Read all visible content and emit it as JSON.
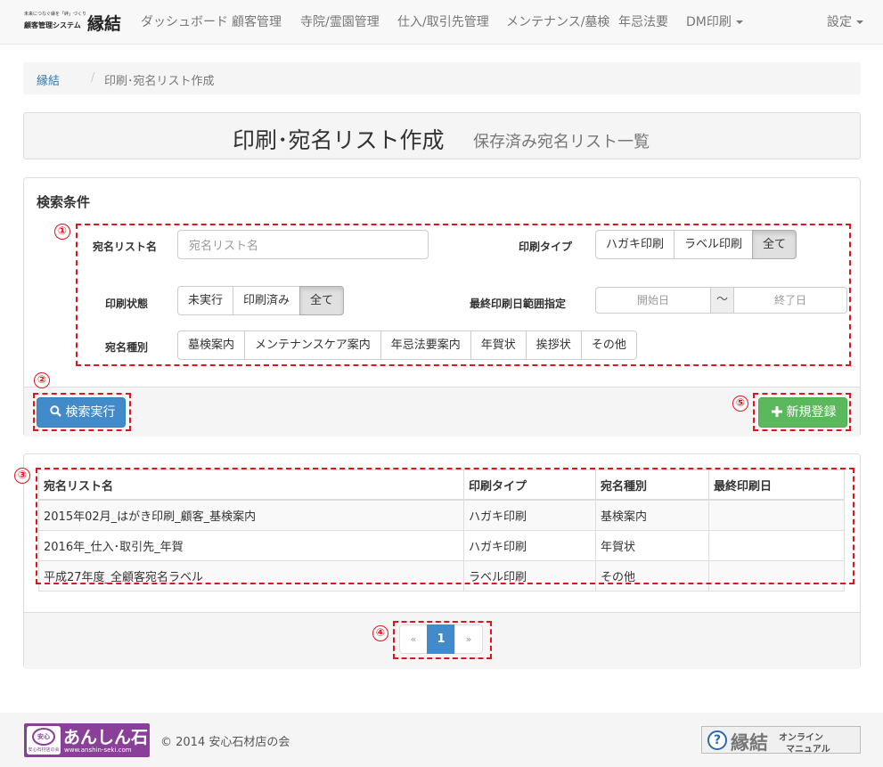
{
  "brand": {
    "tagline": "未来につなぐ縁を「絆」づくり",
    "system": "顧客管理システム",
    "name": "縁結"
  },
  "nav": {
    "items": [
      "ダッシュボード",
      "顧客管理",
      "寺院/霊園管理",
      "仕入/取引先管理",
      "メンテナンス/墓検",
      "年忌法要",
      "DM印刷"
    ],
    "settings": "設定"
  },
  "breadcrumb": {
    "home": "縁結",
    "separator": "/",
    "current": "印刷･宛名リスト作成"
  },
  "page": {
    "title": "印刷･宛名リスト作成",
    "subtitle": "保存済み宛名リスト一覧"
  },
  "search": {
    "heading": "検索条件",
    "list_name_label": "宛名リスト名",
    "list_name_placeholder": "宛名リスト名",
    "print_type_label": "印刷タイプ",
    "print_type_options": [
      "ハガキ印刷",
      "ラベル印刷",
      "全て"
    ],
    "print_status_label": "印刷状態",
    "print_status_options": [
      "未実行",
      "印刷済み",
      "全て"
    ],
    "last_print_label": "最終印刷日範囲指定",
    "date_start_placeholder": "開始日",
    "date_separator": "～",
    "date_end_placeholder": "終了日",
    "address_type_label": "宛名種別",
    "address_type_options": [
      "墓検案内",
      "メンテナンスケア案内",
      "年忌法要案内",
      "年賀状",
      "挨拶状",
      "その他"
    ],
    "search_button": "検索実行",
    "new_button": "新規登録"
  },
  "annotations": [
    "①",
    "②",
    "③",
    "④",
    "⑤"
  ],
  "table": {
    "headers": [
      "宛名リスト名",
      "印刷タイプ",
      "宛名種別",
      "最終印刷日"
    ],
    "rows": [
      [
        "2015年02月_はがき印刷_顧客_基検案内",
        "ハガキ印刷",
        "基検案内",
        ""
      ],
      [
        "2016年_仕入･取引先_年賀",
        "ハガキ印刷",
        "年賀状",
        ""
      ],
      [
        "平成27年度_全顧客宛名ラベル",
        "ラベル印刷",
        "その他",
        ""
      ]
    ]
  },
  "pagination": {
    "prev": "«",
    "current": "1",
    "next": "»"
  },
  "footer": {
    "logo_name": "あんしん石",
    "logo_seal": "安心",
    "logo_seal_text": "安心石材店の会",
    "logo_url": "www.anshin-seki.com",
    "copyright": "© 2014 安心石材店の会",
    "manual_brand": "縁結",
    "manual_line1": "オンライン",
    "manual_line2": "マニュアル",
    "manual_icon": "?"
  },
  "colors": {
    "primary": "#428bca",
    "success": "#5cb85c",
    "annotation": "#e0141e",
    "link": "#337ab7"
  },
  "selected": {
    "print_type": "全て",
    "print_status": "全て",
    "page": 1
  }
}
